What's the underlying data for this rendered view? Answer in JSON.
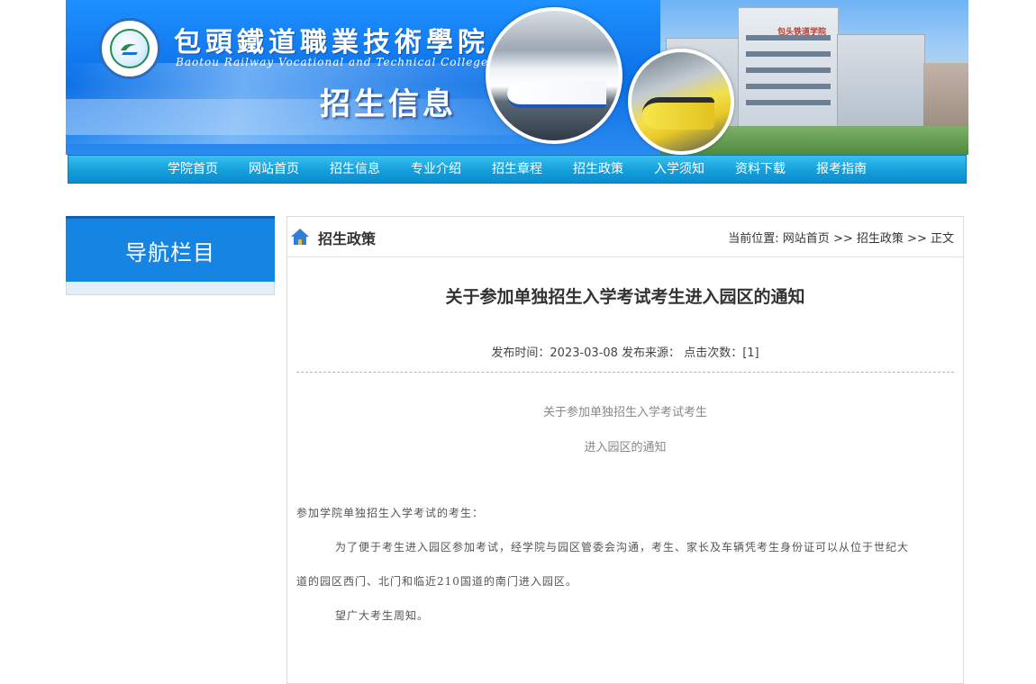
{
  "banner": {
    "school_name_cn": "包頭鐵道職業技術學院",
    "school_name_en": "Baotou Railway Vocational and Technical College",
    "page_heading": "招生信息",
    "campus_sign": "包头铁道学院"
  },
  "nav": {
    "items": [
      {
        "label": "学院首页"
      },
      {
        "label": "网站首页"
      },
      {
        "label": "招生信息"
      },
      {
        "label": "专业介绍"
      },
      {
        "label": "招生章程"
      },
      {
        "label": "招生政策"
      },
      {
        "label": "入学须知"
      },
      {
        "label": "资料下载"
      },
      {
        "label": "报考指南"
      }
    ]
  },
  "sidebar": {
    "title": "导航栏目"
  },
  "content": {
    "section_title": "招生政策",
    "breadcrumb": {
      "prefix": "当前位置:",
      "home": "网站首页",
      "sep": ">>",
      "section": "招生政策",
      "current": "正文"
    },
    "article": {
      "title": "关于参加单独招生入学考试考生进入园区的通知",
      "meta": "发布时间：2023-03-08 发布来源：  点击次数：[1]",
      "subtitle_line1": "关于参加单独招生入学考试考生",
      "subtitle_line2": "进入园区的通知",
      "salutation": "参加学院单独招生入学考试的考生：",
      "para1_line1": "为了便于考生进入园区参加考试，经学院与园区管委会沟通，考生、家长及车辆凭考生身份证可以从位于世纪大",
      "para1_line2": "道的园区西门、北门和临近210国道的南门进入园区。",
      "closing": "望广大考生周知。"
    }
  },
  "colors": {
    "banner_blue": "#0b6fe6",
    "nav_cyan": "#149fdc",
    "sidebar_blue": "#1684e2"
  }
}
